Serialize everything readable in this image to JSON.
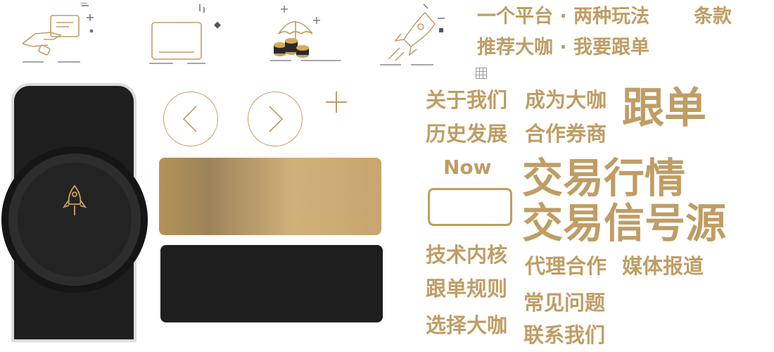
{
  "colors": {
    "gold": "#bf9d64",
    "dark": "#1e1e1e",
    "panel_border": "#dcdcdc"
  },
  "icons": {
    "top_row": [
      "card-payment-icon",
      "laptop-icon",
      "umbrella-coins-icon",
      "rocket-icon"
    ],
    "small": "grid-icon",
    "knob": "rocket-icon",
    "prev": "chevron-left-icon",
    "next": "chevron-right-icon",
    "add": "plus-icon"
  },
  "headline": {
    "line1": "一个平台 · 两种玩法",
    "terms": "条款",
    "line2": "推荐大咖 · 我要跟单"
  },
  "menu": {
    "about": "关于我们",
    "become_expert": "成为大咖",
    "follow": "跟单",
    "history": "历史发展",
    "broker": "合作券商",
    "now": "Now",
    "market": "交易行情",
    "signal": "交易信号源",
    "tech": "技术内核",
    "agent": "代理合作",
    "media": "媒体报道",
    "rules": "跟单规则",
    "faq": "常见问题",
    "choose_expert": "选择大咖",
    "contact": "联系我们"
  }
}
